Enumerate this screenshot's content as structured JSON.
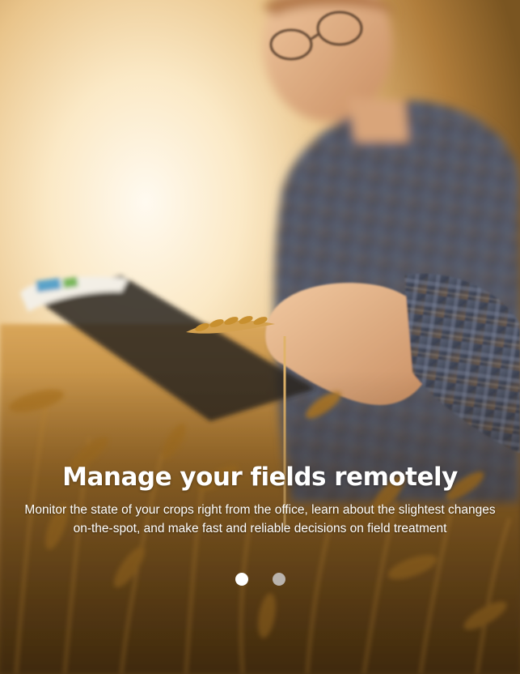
{
  "slide": {
    "title": "Manage your fields remotely",
    "description": "Monitor the state of your crops right from the office, learn about the slightest changes on-the-spot, and make fast and reliable decisions on field treatment"
  },
  "carousel": {
    "total_slides": 2,
    "active_index": 0,
    "active_dot_color": "#ffffff",
    "inactive_dot_color": "#b9b3ad"
  },
  "colors": {
    "text": "#ffffff",
    "wheat": "#c8902f",
    "sunlight": "#fff6e2"
  }
}
